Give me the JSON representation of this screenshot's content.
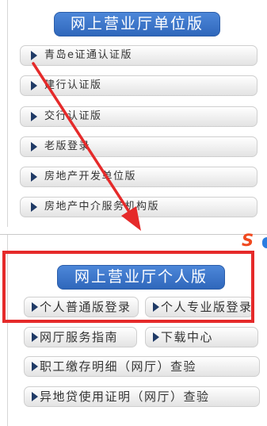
{
  "unit_section": {
    "title": "网上营业厅单位版",
    "item_icon": "triangle-right-icon",
    "items": [
      {
        "label": "青岛e证通认证版"
      },
      {
        "label": "建行认证版"
      },
      {
        "label": "交行认证版"
      },
      {
        "label": "老版登录"
      },
      {
        "label": "房地产开发单位版"
      },
      {
        "label": "房地产中介服务机构版"
      }
    ]
  },
  "personal_section": {
    "title": "网上营业厅个人版",
    "item_icon": "triangle-right-icon",
    "login_buttons": [
      {
        "label": "个人普通版登录"
      },
      {
        "label": "个人专业版登录"
      }
    ],
    "service_links": [
      {
        "label": "网厅服务指南"
      },
      {
        "label": "下载中心"
      }
    ],
    "verification_links": [
      {
        "label": "职工缴存明细（网厅）查验"
      },
      {
        "label": "异地贷使用证明（网厅）查验"
      }
    ]
  },
  "annotations": {
    "arrow": {
      "icon": "arrow-down-right-icon",
      "color": "#e52a2a"
    },
    "highlight_box": {
      "color": "#e52a2a"
    }
  },
  "system_tray": {
    "ime_icon": {
      "icon": "sogou-ime-icon",
      "glyph": "S",
      "color": "#f0491f"
    }
  },
  "colors": {
    "header_blue": "#3a73c6",
    "icon_navy": "#1f3a66",
    "button_text": "#333333"
  }
}
